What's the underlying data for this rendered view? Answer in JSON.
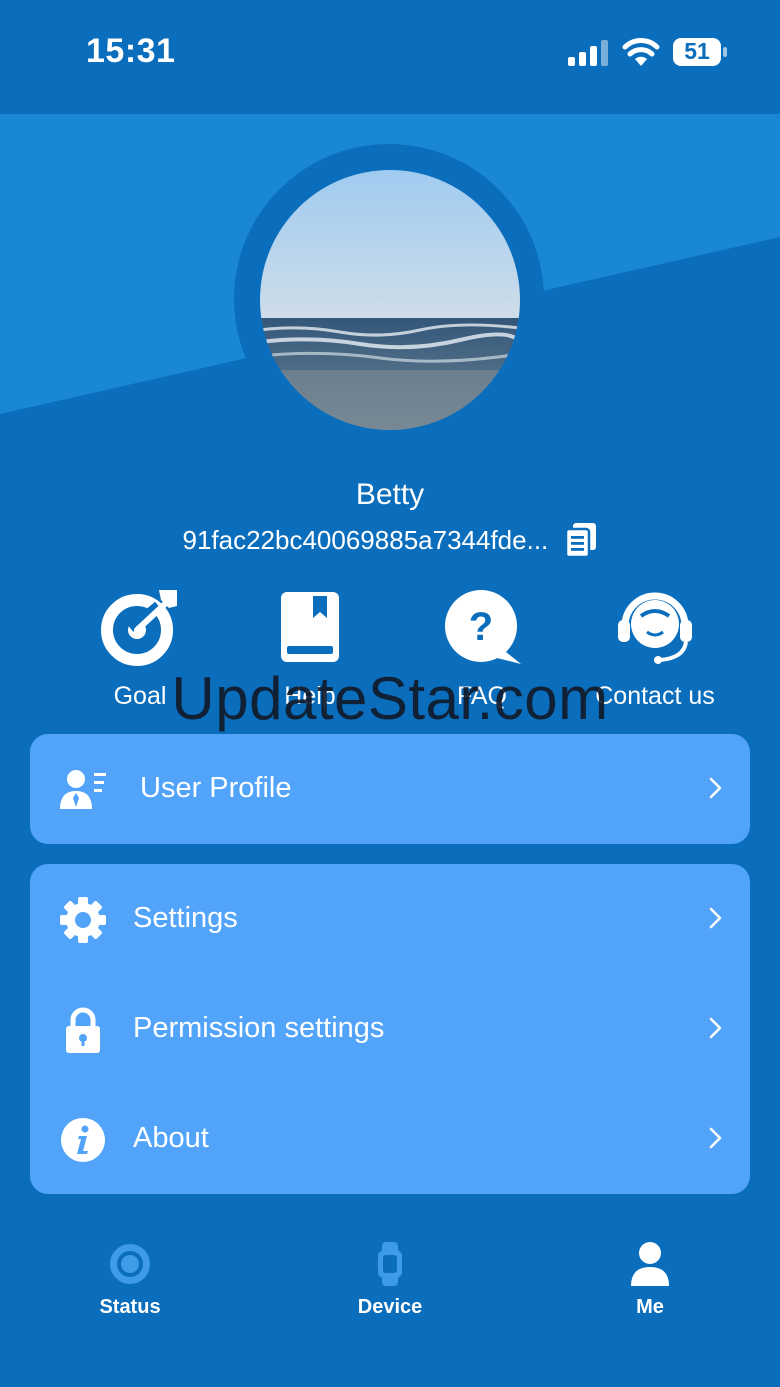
{
  "status_bar": {
    "time": "15:31",
    "battery": "51"
  },
  "profile": {
    "name": "Betty",
    "user_id": "91fac22bc40069885a7344fde..."
  },
  "quick_actions": [
    {
      "label": "Goal",
      "icon": "goal-target-icon"
    },
    {
      "label": "Help",
      "icon": "help-book-icon"
    },
    {
      "label": "FAQ",
      "icon": "faq-question-icon"
    },
    {
      "label": "Contact us",
      "icon": "headset-icon"
    }
  ],
  "watermark": "UpdateStar.com",
  "menu": {
    "user_profile": "User Profile",
    "settings": "Settings",
    "permission_settings": "Permission settings",
    "about": "About"
  },
  "tabs": {
    "status": "Status",
    "device": "Device",
    "me": "Me"
  },
  "colors": {
    "background": "#0a6ebd",
    "header_light": "#1a86d6",
    "card": "#52a4fb",
    "tab_inactive": "#3d9be8",
    "tab_active": "#ffffff"
  }
}
